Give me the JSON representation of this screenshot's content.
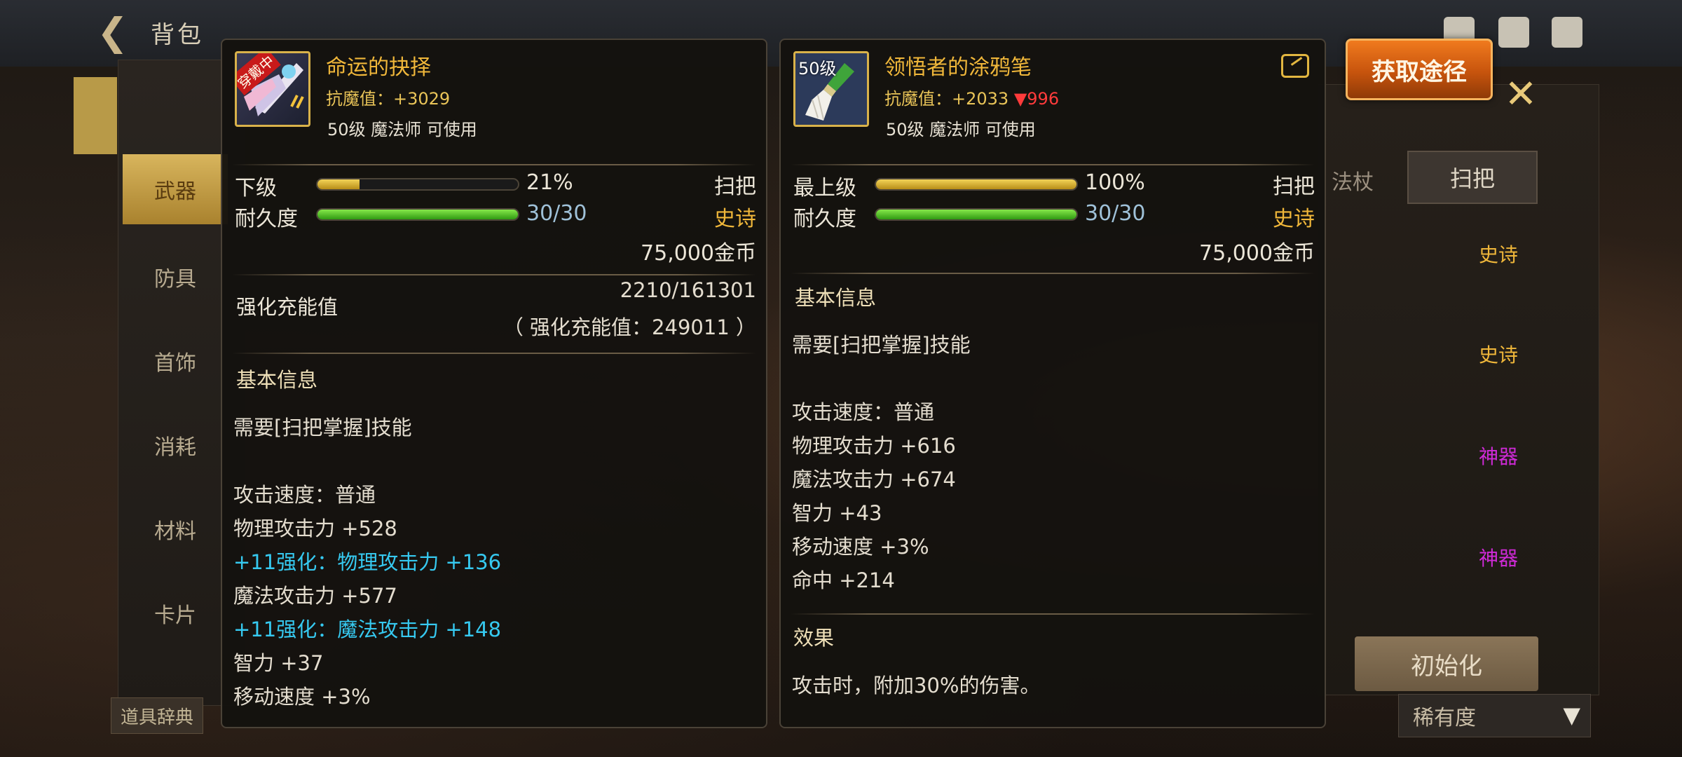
{
  "header": {
    "title": "背包"
  },
  "categories": [
    "武器",
    "防具",
    "首饰",
    "消耗",
    "材料",
    "卡片"
  ],
  "dict_button": "道具辞典",
  "obtain_button": "获取途径",
  "side": {
    "broom_tab": "扫把",
    "staff_tab": "法杖",
    "rarities": [
      {
        "label": "史诗",
        "color": "#f0b73a"
      },
      {
        "label": "史诗",
        "color": "#f0b73a"
      },
      {
        "label": "神器",
        "color": "#d02ad8"
      },
      {
        "label": "神器",
        "color": "#d02ad8"
      }
    ],
    "init_button": "初始化",
    "sort_select": "稀有度"
  },
  "card1": {
    "equipped": "穿戴中",
    "name": "命运的抉择",
    "magic_res_label": "抗魔值：",
    "magic_res_value": "+3029",
    "requirement": "50级 魔法师 可使用",
    "grade_label": "下级",
    "grade_pct": "21%",
    "grade_fraction": 0.21,
    "type": "扫把",
    "durability_label": "耐久度",
    "durability": "30/30",
    "durability_fraction": 1.0,
    "rarity": "史诗",
    "price": "75,000金币",
    "enhance_label": "强化充能值",
    "enhance_value": "2210/161301",
    "enhance_total": "（ 强化充能值：249011 ）",
    "basic_info": "基本信息",
    "skill_req": "需要[扫把掌握]技能",
    "stats": [
      {
        "text": "攻击速度：普通",
        "blue": false
      },
      {
        "text": "物理攻击力 +528",
        "blue": false
      },
      {
        "text": "+11强化：物理攻击力 +136",
        "blue": true
      },
      {
        "text": "魔法攻击力 +577",
        "blue": false
      },
      {
        "text": "+11强化：魔法攻击力 +148",
        "blue": true
      },
      {
        "text": "智力 +37",
        "blue": false
      },
      {
        "text": "移动速度 +3%",
        "blue": false
      }
    ]
  },
  "card2": {
    "level_tag": "50级",
    "name": "领悟者的涂鸦笔",
    "magic_res_label": "抗魔值：",
    "magic_res_value": "+2033",
    "magic_res_diff": "▼996",
    "requirement": "50级 魔法师 可使用",
    "grade_label": "最上级",
    "grade_pct": "100%",
    "grade_fraction": 1.0,
    "type": "扫把",
    "durability_label": "耐久度",
    "durability": "30/30",
    "durability_fraction": 1.0,
    "rarity": "史诗",
    "price": "75,000金币",
    "basic_info": "基本信息",
    "skill_req": "需要[扫把掌握]技能",
    "stats": [
      "攻击速度：普通",
      "物理攻击力 +616",
      "魔法攻击力 +674",
      "智力 +43",
      "移动速度 +3%",
      "命中 +214"
    ],
    "effect_title": "效果",
    "effect_text": "攻击时，附加30%的伤害。"
  }
}
